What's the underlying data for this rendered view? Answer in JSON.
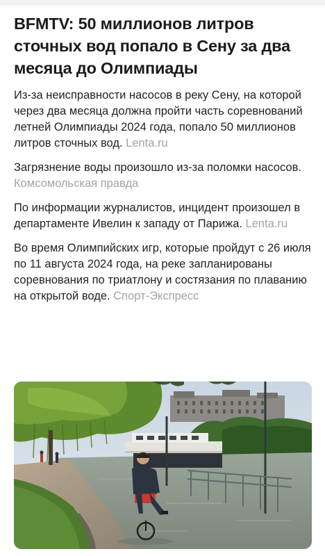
{
  "article": {
    "headline": "BFMTV: 50 миллионов литров сточных вод попало в Сену за два месяца до Олимпиады",
    "paragraphs": [
      {
        "text": "Из-за неисправности насосов в реку Сену, на которой через два месяца должна пройти часть соревнований летней Олимпиады 2024 года, попало 50 миллионов литров сточных вод.",
        "source": "Lenta.ru"
      },
      {
        "text": "Загрязнение воды произошло из-за поломки насосов.",
        "source": "Комсомольская правда"
      },
      {
        "text": "По информации журналистов, инцидент произошел в департаменте Ивелин к западу от Парижа.",
        "source": "Lenta.ru"
      },
      {
        "text": "Во время Олимпийских игр, которые пройдут с 26 июля по 11 августа 2024 года, на реке запланированы соревнования по триатлону и состязания по плаванию на открытой воде.",
        "source": "Спорт-Экспресс"
      }
    ]
  },
  "colors": {
    "text": "#1b1b1b",
    "source": "#a3a3a6",
    "background": "#ffffff"
  }
}
